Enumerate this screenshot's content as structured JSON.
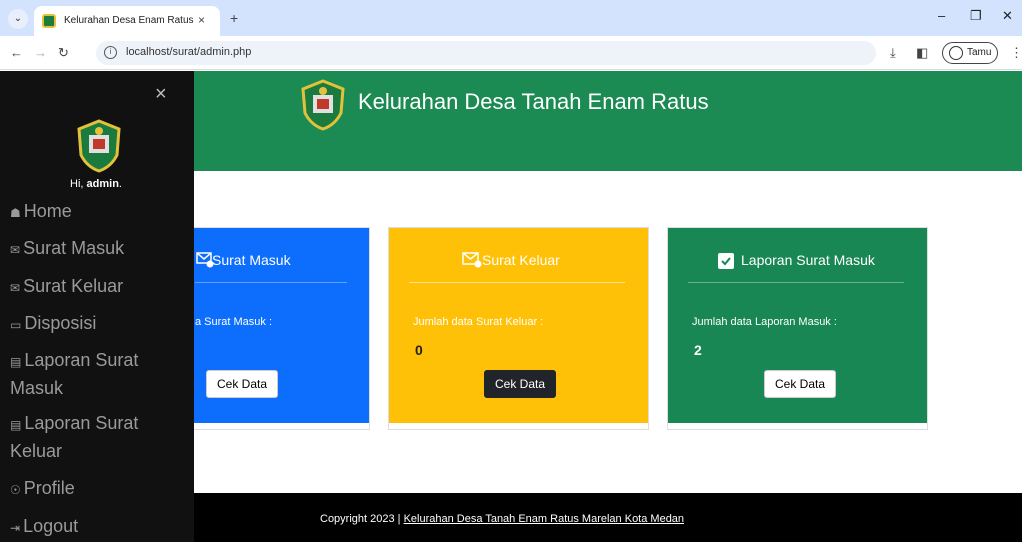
{
  "browser": {
    "tab_title": "Kelurahan Desa Enam Ratus",
    "tab_close": "×",
    "new_tab": "+",
    "url": "localhost/surat/admin.php",
    "profile_label": "Tamu",
    "icons": [
      "chevron-down-icon",
      "favicon",
      "close-icon",
      "plus-icon",
      "minimize-icon",
      "restore-icon",
      "close-window-icon",
      "back-icon",
      "forward-icon",
      "reload-icon",
      "info-icon",
      "download-icon",
      "sidepanel-icon",
      "profile-icon",
      "more-icon"
    ]
  },
  "sidebar": {
    "close": "×",
    "greeting": "Hi,",
    "username": "admin",
    "greeting_suffix": ".",
    "items": [
      {
        "icon": "☗",
        "label": "Home"
      },
      {
        "icon": "✉",
        "label": "Surat Masuk"
      },
      {
        "icon": "✉",
        "label": "Surat Keluar"
      },
      {
        "icon": "▭",
        "label": "Disposisi"
      },
      {
        "icon": "▤",
        "label": "Laporan Surat Masuk"
      },
      {
        "icon": "▤",
        "label": "Laporan Surat Keluar"
      },
      {
        "icon": "☉",
        "label": "Profile"
      },
      {
        "icon": "⇥",
        "label": "Logout"
      }
    ]
  },
  "header": {
    "title": "Kelurahan Desa Tanah Enam Ratus"
  },
  "cards": [
    {
      "title": "Surat Masuk",
      "label": "a Surat Masuk :",
      "count": "",
      "button": "Cek Data",
      "color": "#0d6efd",
      "icon": "envelope-plus-icon"
    },
    {
      "title": "Surat Keluar",
      "label": "Jumlah data Surat Keluar :",
      "count": "0",
      "button": "Cek Data",
      "color": "#ffc107",
      "icon": "envelope-plus-icon"
    },
    {
      "title": "Laporan Surat Masuk",
      "label": "Jumlah data Laporan Masuk :",
      "count": "2",
      "button": "Cek Data",
      "color": "#198754",
      "icon": "bookmark-check-icon"
    }
  ],
  "footer": {
    "prefix": "Copyright 2023 | ",
    "link": "Kelurahan Desa Tanah Enam Ratus Marelan Kota Medan"
  }
}
